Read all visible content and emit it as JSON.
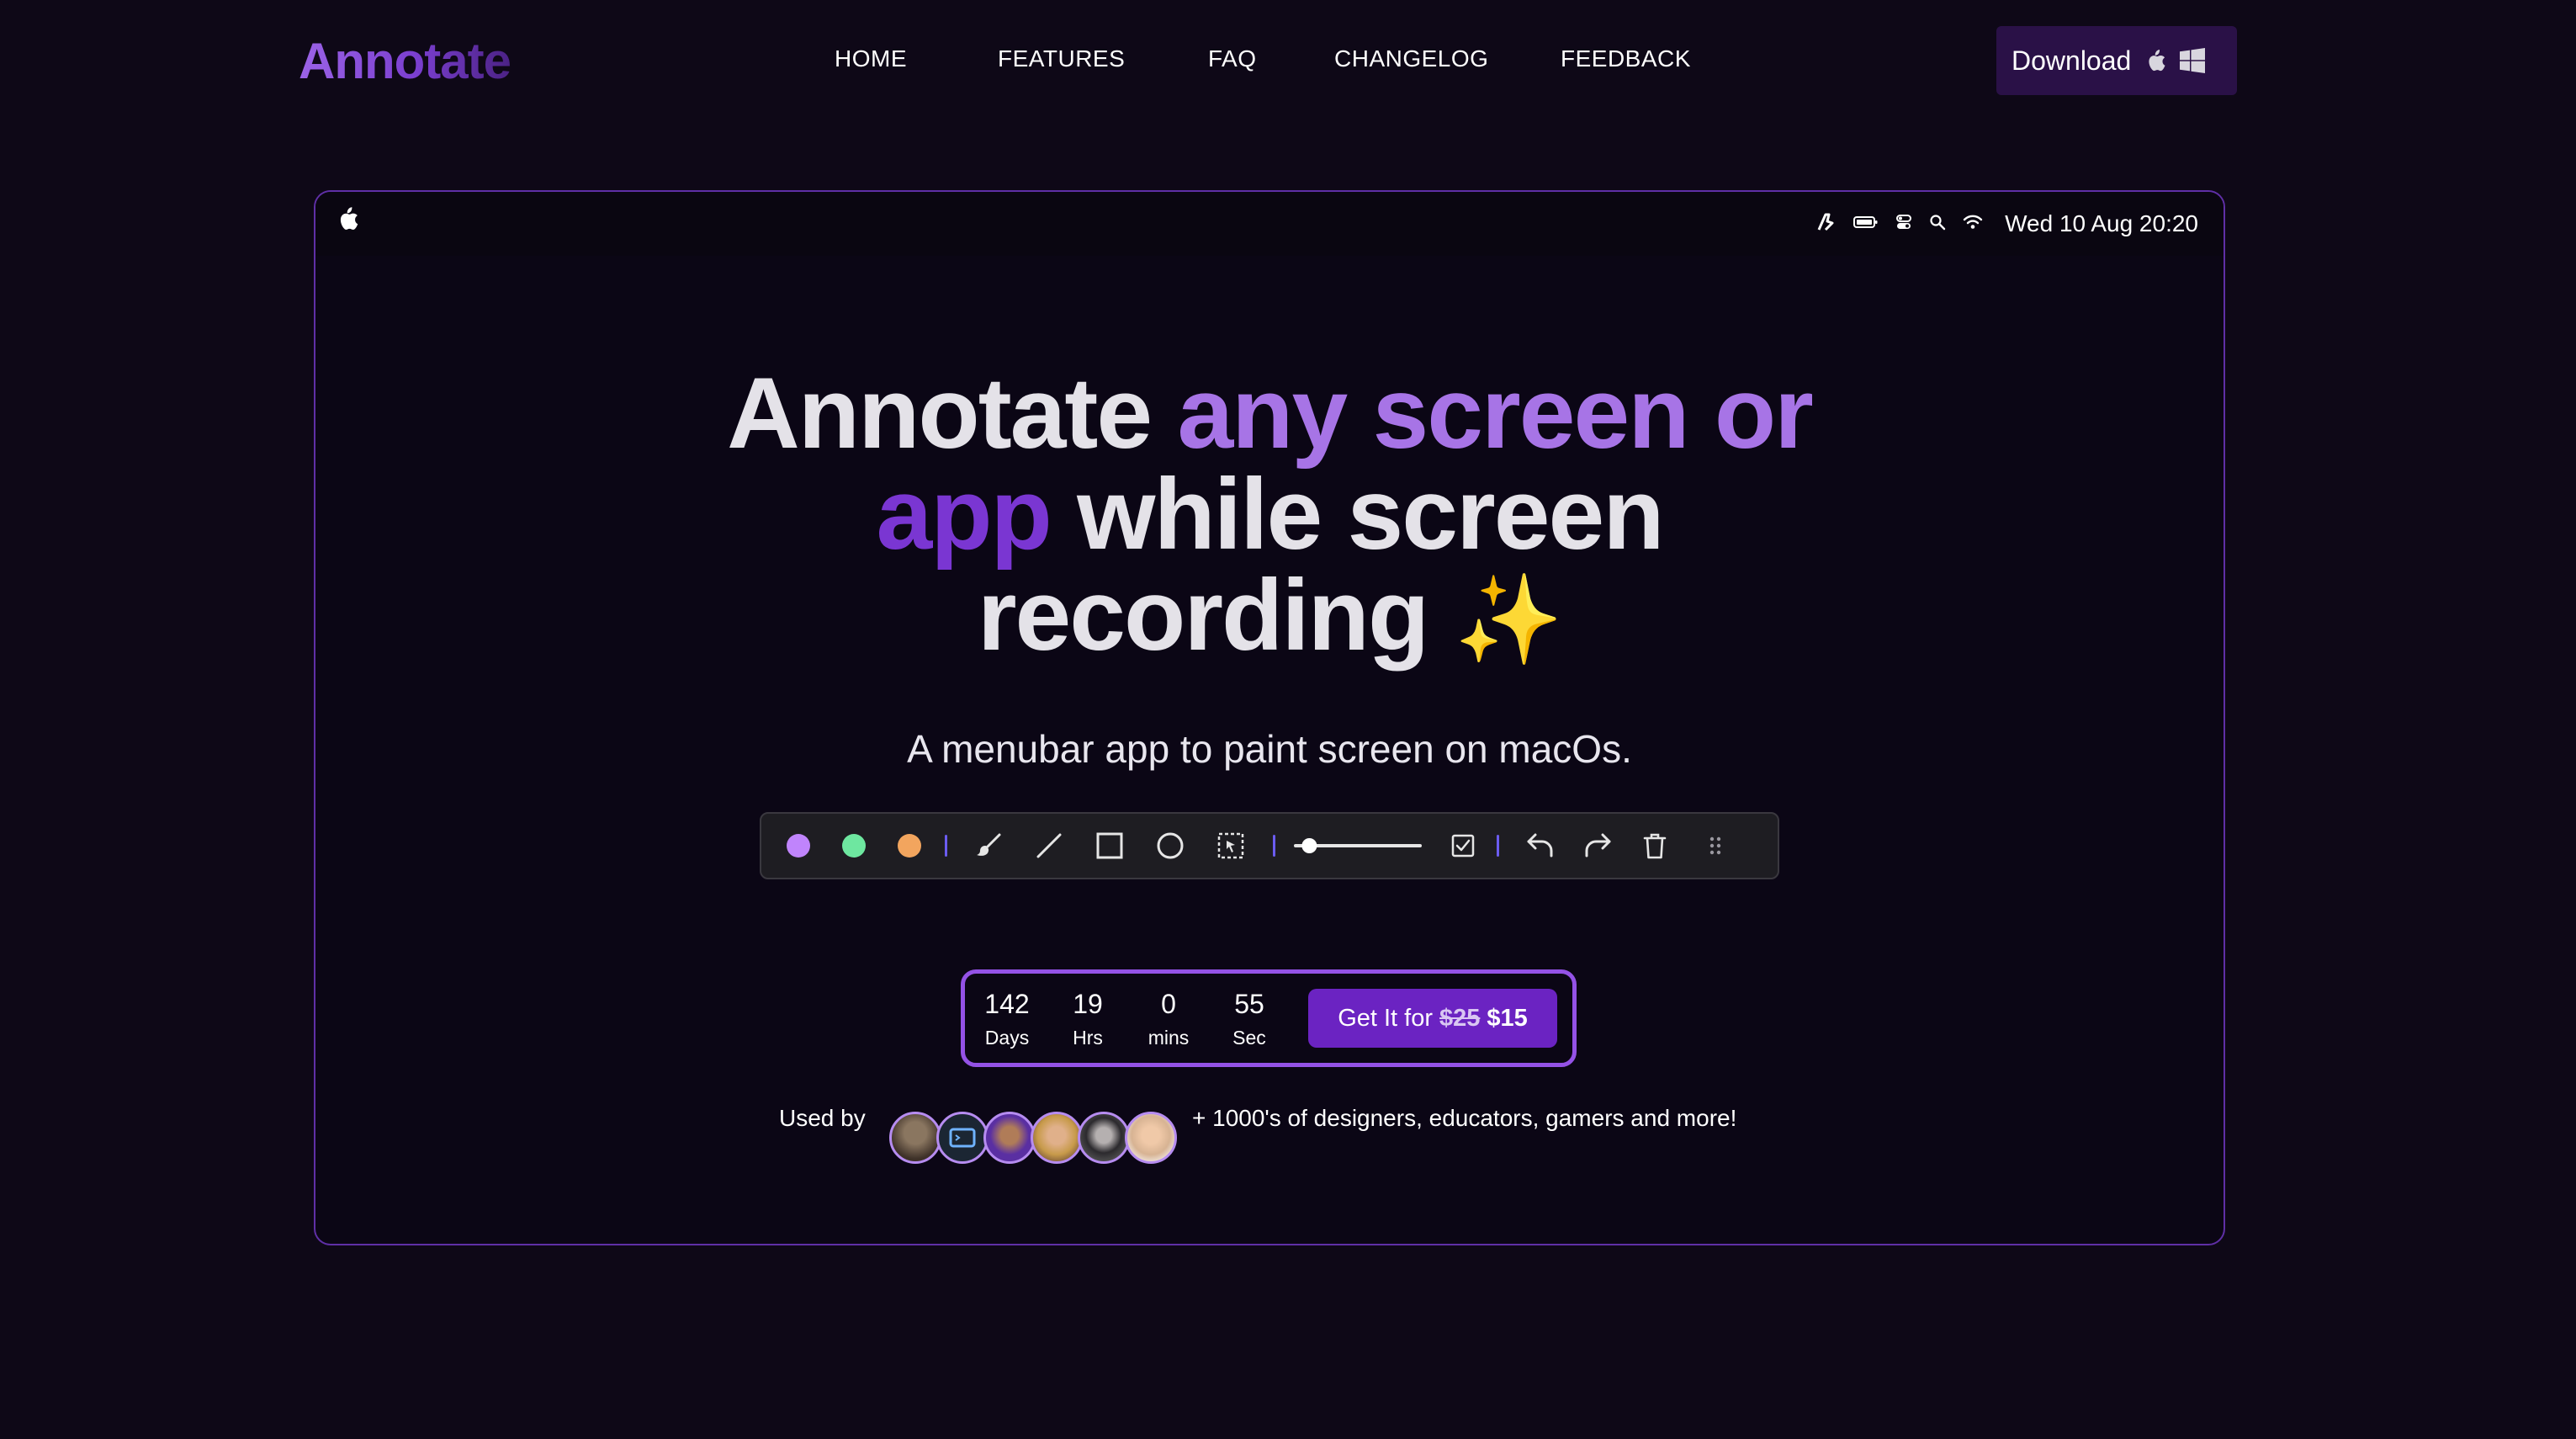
{
  "brand": {
    "logo": "Annotate"
  },
  "nav": {
    "items": [
      "HOME",
      "FEATURES",
      "FAQ",
      "CHANGELOG",
      "FEEDBACK"
    ]
  },
  "download": {
    "label": "Download",
    "icons": [
      "apple-icon",
      "windows-icon"
    ]
  },
  "menubar": {
    "icons": [
      "apple-logo-icon",
      "annotate-app-icon",
      "battery-icon",
      "control-center-icon",
      "search-icon",
      "wifi-icon"
    ],
    "datetime": "Wed 10 Aug 20:20"
  },
  "hero": {
    "line1_a": "Annotate ",
    "line1_b": "any screen or",
    "line2_a": "app",
    "line2_b": " while screen",
    "line3": "recording",
    "sparkle": "✨",
    "subtitle": "A menubar app to paint screen on macOs."
  },
  "toolbar": {
    "colors": [
      "#c084fc",
      "#6ee7a0",
      "#f2a55e"
    ],
    "tools": [
      "brush-icon",
      "line-icon",
      "rectangle-icon",
      "circle-icon",
      "select-icon",
      "size-slider",
      "checkbox-icon",
      "undo-icon",
      "redo-icon",
      "trash-icon",
      "drag-handle-icon"
    ],
    "slider_value": 0.1,
    "accent": "#6b5cf0"
  },
  "countdown": {
    "days": "142",
    "days_label": "Days",
    "hours": "19",
    "hours_label": "Hrs",
    "mins": "0",
    "mins_label": "mins",
    "secs": "55",
    "secs_label": "Sec",
    "buy_prefix": "Get It for",
    "old_price": "$25",
    "new_price": "$15"
  },
  "social": {
    "used_by": "Used by",
    "avatar_count": 6,
    "tagline": "+ 1000's of designers, educators, gamers and more!"
  },
  "colors": {
    "background": "#0e0817",
    "accent": "#7a36d2",
    "accent_light": "#a774e6",
    "frame_border": "#5f2fa6"
  }
}
